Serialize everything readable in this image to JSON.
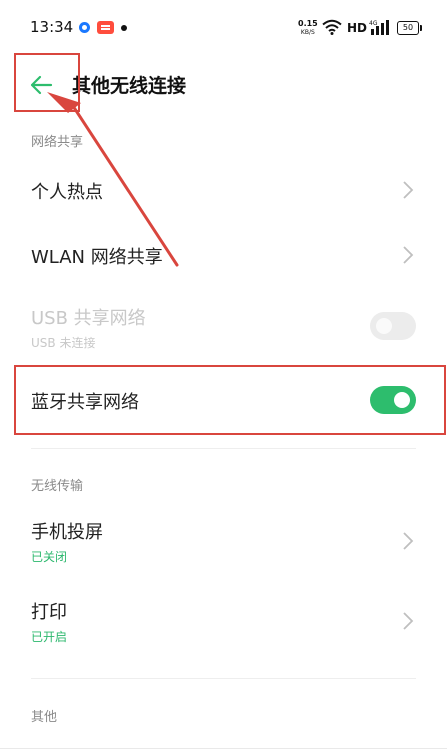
{
  "status_bar": {
    "time": "13:34",
    "net_speed_value": "0.15",
    "net_speed_unit": "KB/S",
    "hd_label": "HD",
    "network_type": "4G",
    "battery": "50",
    "icons": [
      "app-notification-icon",
      "app-notification-icon",
      "dot-icon",
      "wifi-icon",
      "signal-icon",
      "battery-icon"
    ]
  },
  "header": {
    "back_icon": "arrow-left-icon",
    "title": "其他无线连接"
  },
  "sections": {
    "network_sharing": {
      "label": "网络共享",
      "items": [
        {
          "title": "个人热点"
        },
        {
          "title": "WLAN 网络共享"
        },
        {
          "title": "USB 共享网络",
          "subtitle": "USB 未连接",
          "toggle": "off",
          "disabled": true
        },
        {
          "title": "蓝牙共享网络",
          "toggle": "on"
        }
      ]
    },
    "wireless_transfer": {
      "label": "无线传输",
      "items": [
        {
          "title": "手机投屏",
          "subtitle": "已关闭"
        },
        {
          "title": "打印",
          "subtitle": "已开启"
        }
      ]
    },
    "other": {
      "label": "其他"
    }
  },
  "colors": {
    "accent_green": "#2dbd6d",
    "subtitle_green": "#2db86e",
    "annotation_red": "#d9463e",
    "disabled_text": "#c8c8c8"
  }
}
